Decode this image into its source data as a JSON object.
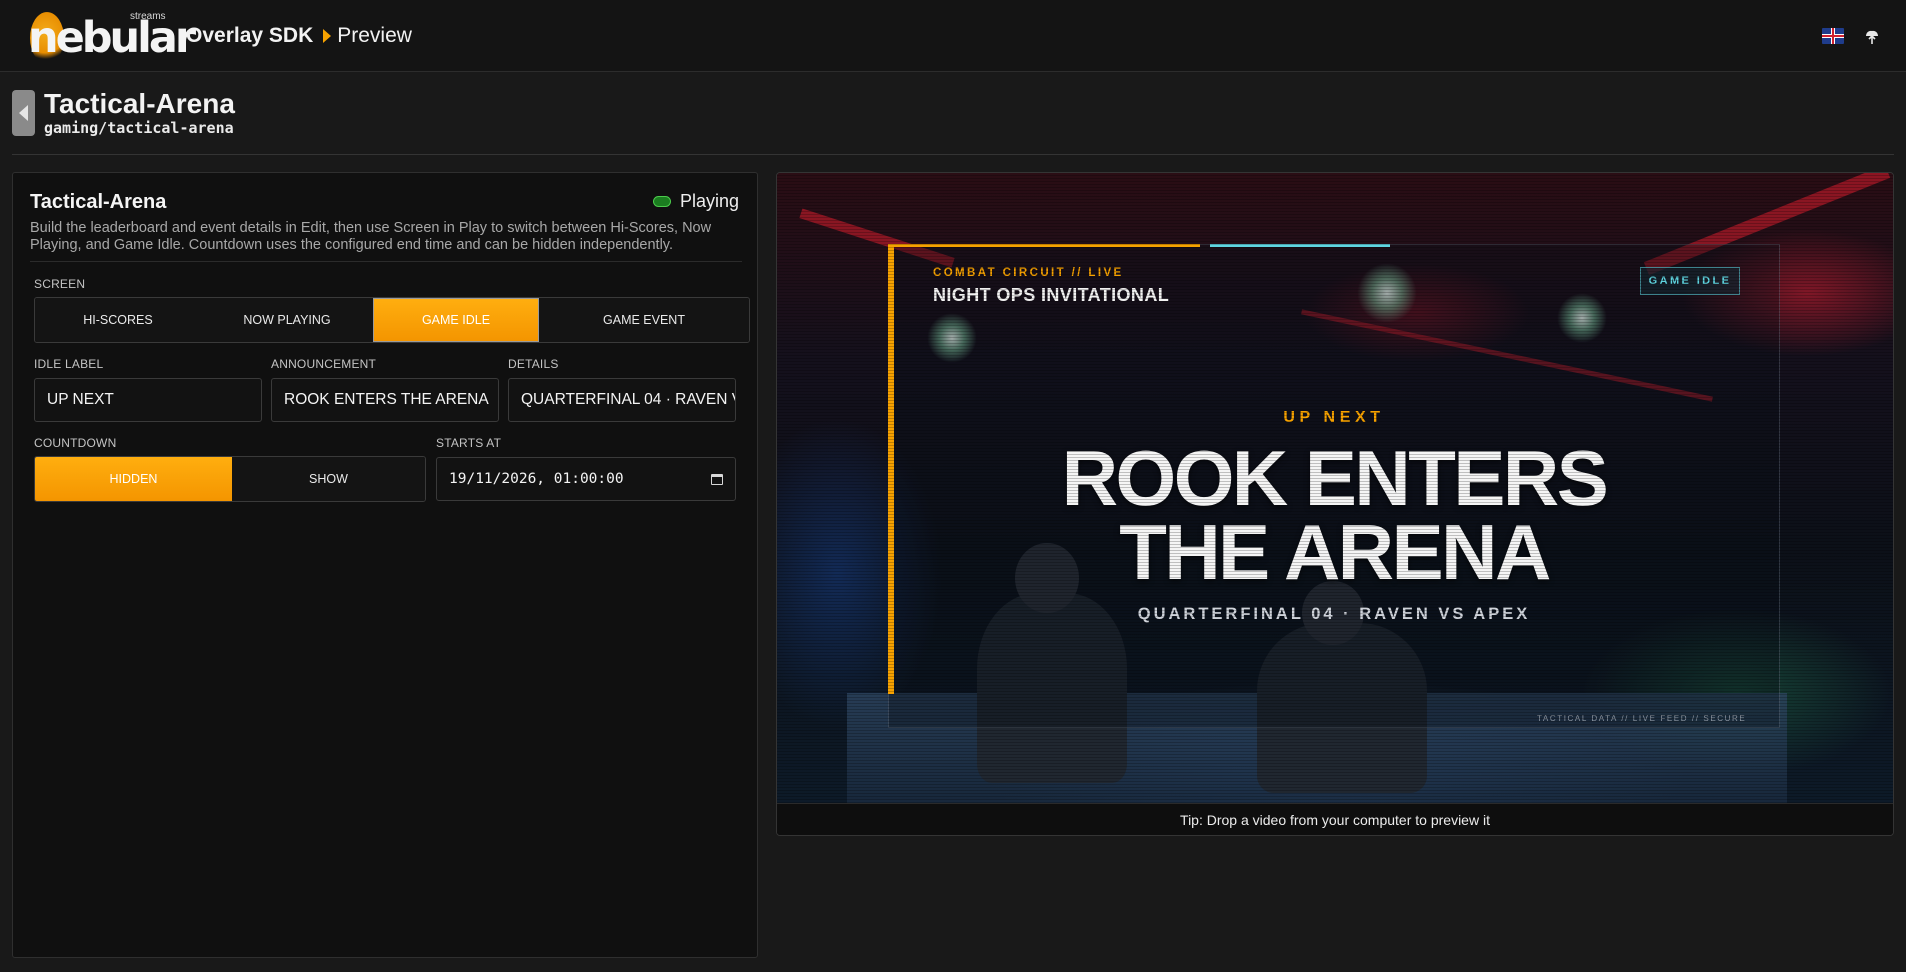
{
  "brand": {
    "logo_text": "nebular",
    "logo_sub": "streams"
  },
  "breadcrumb": {
    "app": "Overlay SDK",
    "page": "Preview"
  },
  "header_icons": {
    "language": "uk-flag-icon",
    "cloud": "cloud-upload-icon"
  },
  "project": {
    "title": "Tactical-Arena",
    "slug": "gaming/tactical-arena"
  },
  "panel": {
    "title": "Tactical-Arena",
    "status": "Playing",
    "description": "Build the leaderboard and event details in Edit, then use Screen in Play to switch between Hi-Scores, Now Playing, and Game Idle. Countdown uses the configured end time and can be hidden independently.",
    "screen": {
      "label": "SCREEN",
      "options": [
        "HI-SCORES",
        "NOW PLAYING",
        "GAME IDLE",
        "GAME EVENT"
      ],
      "selected": "GAME IDLE"
    },
    "idle_label": {
      "label": "IDLE LABEL",
      "value": "UP NEXT"
    },
    "announcement": {
      "label": "ANNOUNCEMENT",
      "value": "ROOK ENTERS THE ARENA"
    },
    "details": {
      "label": "DETAILS",
      "value": "QUARTERFINAL 04 · RAVEN VS APEX"
    },
    "countdown": {
      "label": "COUNTDOWN",
      "options": [
        "HIDDEN",
        "SHOW"
      ],
      "selected": "HIDDEN"
    },
    "starts_at": {
      "label": "STARTS AT",
      "value": "19/11/2026, 01:00:00"
    }
  },
  "overlay": {
    "kicker": "COMBAT CIRCUIT // LIVE",
    "event": "NIGHT OPS INVITATIONAL",
    "badge": "GAME IDLE",
    "label": "UP NEXT",
    "headline": "ROOK ENTERS THE ARENA",
    "details": "QUARTERFINAL 04 · RAVEN VS APEX",
    "footer": "TACTICAL DATA // LIVE FEED // SECURE"
  },
  "tip": "Tip: Drop a video from your computer to preview it",
  "colors": {
    "accent": "#f7a200",
    "cyan": "#5fd5e0",
    "status_green": "#1b7d20"
  }
}
